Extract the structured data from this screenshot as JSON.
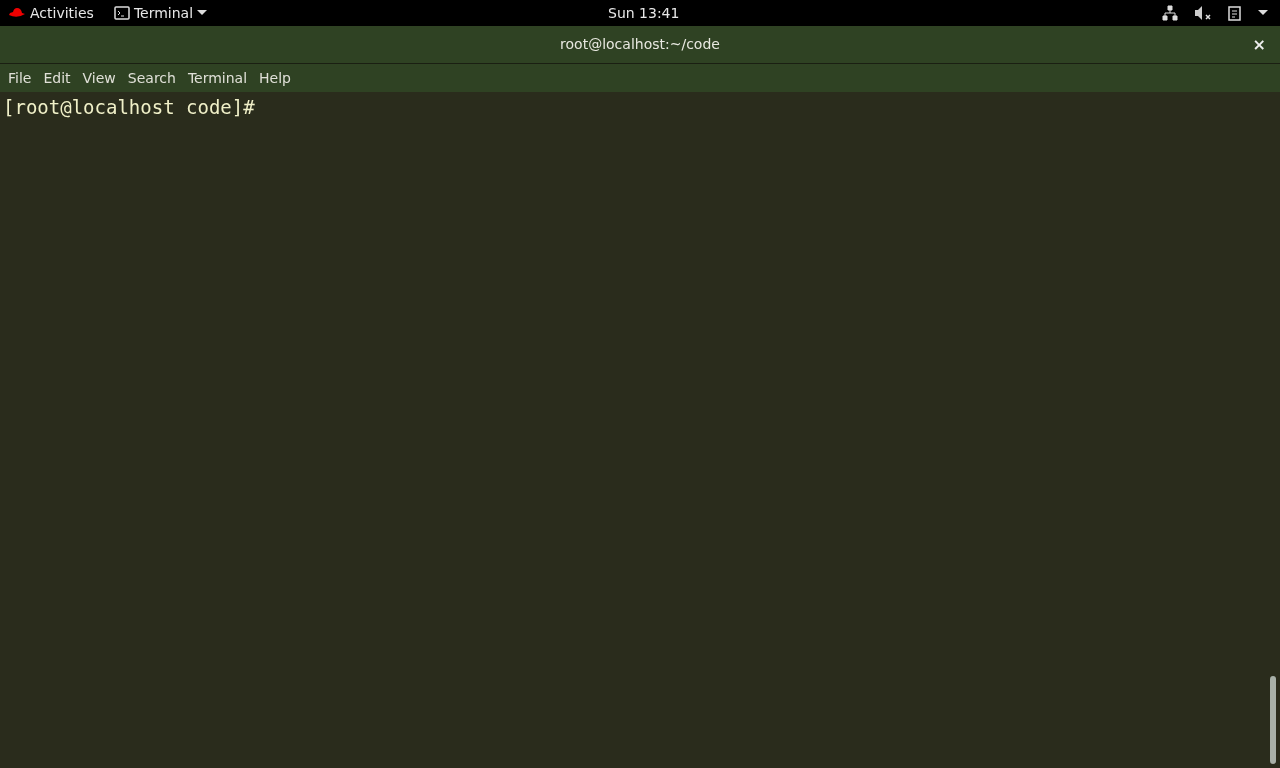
{
  "top_bar": {
    "activities": "Activities",
    "app_menu": "Terminal",
    "clock": "Sun 13:41"
  },
  "window": {
    "title": "root@localhost:~/code",
    "close": "×"
  },
  "menu": [
    "File",
    "Edit",
    "View",
    "Search",
    "Terminal",
    "Help"
  ],
  "terminal": {
    "lines": [
      "[root@localhost code]#"
    ]
  }
}
